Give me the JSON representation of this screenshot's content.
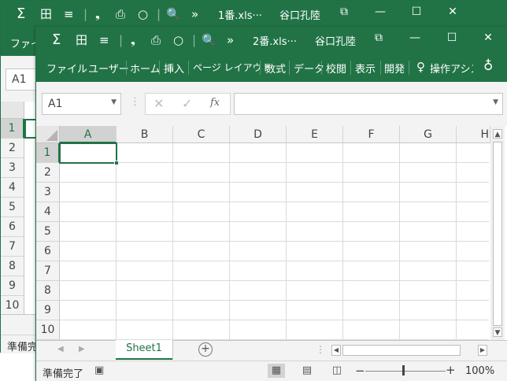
{
  "back_window": {
    "filename": "1番.xls···",
    "user": "谷口孔陸",
    "tab_file": "ファイル",
    "name_box": "A1",
    "rows": [
      "1",
      "2",
      "3",
      "4",
      "5",
      "6",
      "7",
      "8",
      "9",
      "10"
    ],
    "status": "準備完了"
  },
  "front_window": {
    "filename": "2番.xls···",
    "user": "谷口孔陸",
    "ribbon_tabs": [
      "ファイル",
      "ユーザー",
      "ホーム",
      "挿入",
      "ページ レイアウト",
      "数式",
      "データ",
      "校閲",
      "表示",
      "開発"
    ],
    "tell_me": "操作アシスト",
    "name_box": "A1",
    "formula_value": "",
    "columns": [
      "A",
      "B",
      "C",
      "D",
      "E",
      "F",
      "G",
      "H"
    ],
    "rows": [
      "1",
      "2",
      "3",
      "4",
      "5",
      "6",
      "7",
      "8",
      "9",
      "10"
    ],
    "selected_cell": "A1",
    "sheet_tab": "Sheet1",
    "status": "準備完了",
    "zoom": "100%"
  },
  "icons": {
    "autosum": "Σ",
    "borders": "田",
    "align": "≡",
    "comma": "❟",
    "preview": "⎙",
    "shape": "○",
    "zoom": "🔍",
    "more": "»",
    "restore": "⧉",
    "minimize": "—",
    "maximize": "☐",
    "close": "✕",
    "lightbulb": "💡",
    "share": "👤",
    "fx": "fx",
    "cancel": "✕",
    "enter": "✓"
  },
  "colors": {
    "excel_green": "#217346",
    "grid_line": "#dadada",
    "header_bg": "#f3f3f3",
    "selected_header": "#d2d2d2"
  }
}
